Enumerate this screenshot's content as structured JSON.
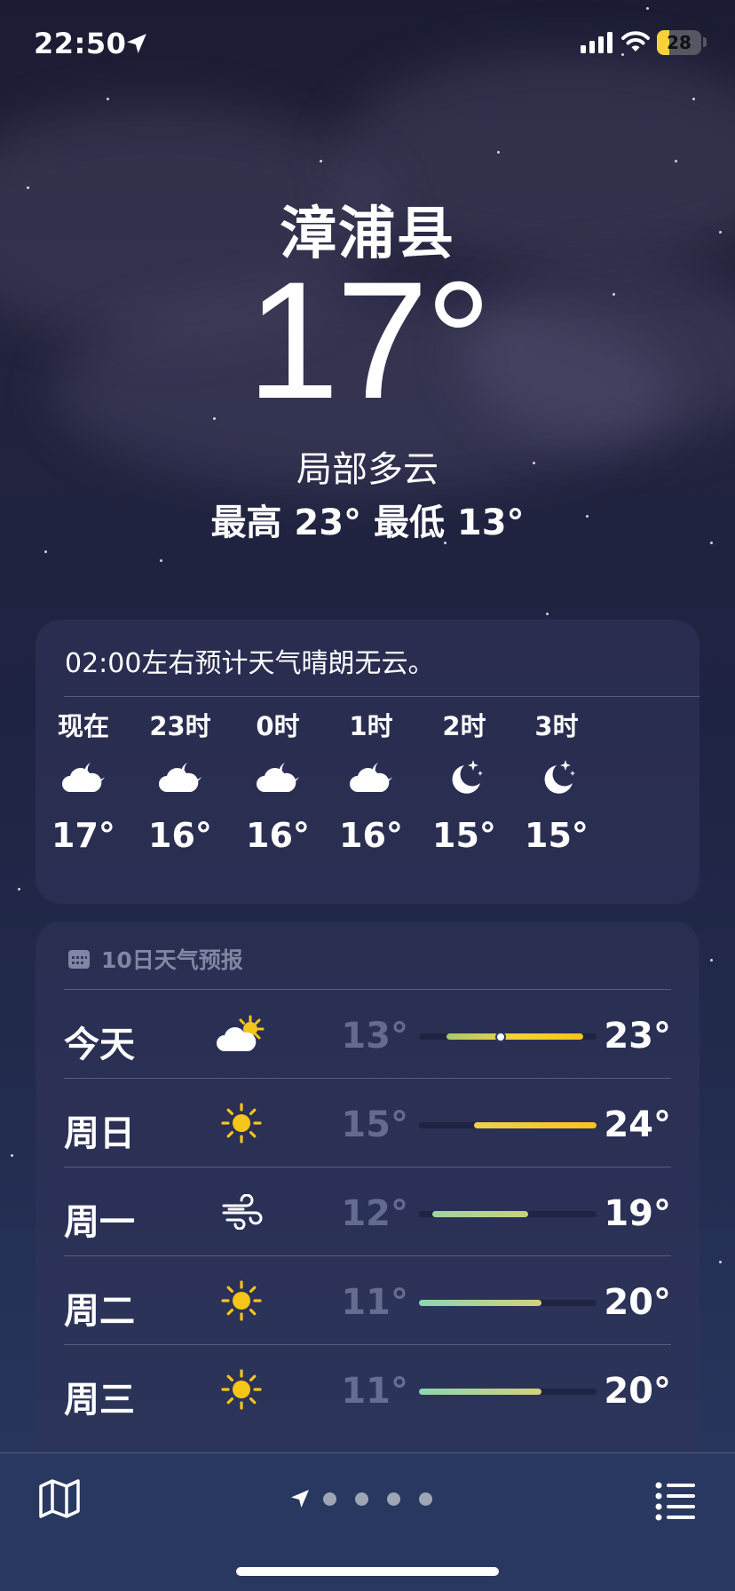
{
  "status_bar": {
    "time": "22:50",
    "battery": "28",
    "battery_level": 0.28,
    "icons": [
      "location-arrow-icon",
      "signal-icon",
      "wifi-icon",
      "battery-charging-icon"
    ]
  },
  "location": {
    "city": "漳浦县",
    "temperature": "17°",
    "condition": "局部多云",
    "high_low": "最高 23°  最低 13°"
  },
  "hourly": {
    "summary": "02:00左右预计天气晴朗无云。",
    "items": [
      {
        "label": "现在",
        "icon": "cloud-moon-icon",
        "temp": "17°"
      },
      {
        "label": "23时",
        "icon": "cloud-moon-icon",
        "temp": "16°"
      },
      {
        "label": "0时",
        "icon": "cloud-moon-icon",
        "temp": "16°"
      },
      {
        "label": "1时",
        "icon": "cloud-moon-icon",
        "temp": "16°"
      },
      {
        "label": "2时",
        "icon": "moon-stars-icon",
        "temp": "15°"
      },
      {
        "label": "3时",
        "icon": "moon-stars-icon",
        "temp": "15°"
      }
    ]
  },
  "daily": {
    "header": "10日天气预报",
    "header_icon": "calendar-icon",
    "range_min": 11,
    "range_max": 24,
    "days": [
      {
        "day": "今天",
        "icon": "cloud-sun-icon",
        "low": "13°",
        "high": "23°",
        "low_value": 13,
        "high_value": 23,
        "current_value": 17,
        "colors": [
          "#a8c96a",
          "#f3d23b",
          "#f7c31c"
        ]
      },
      {
        "day": "周日",
        "icon": "sun-icon",
        "low": "15°",
        "high": "24°",
        "low_value": 15,
        "high_value": 24,
        "colors": [
          "#f1cf52",
          "#f7c31c"
        ]
      },
      {
        "day": "周一",
        "icon": "wind-icon",
        "low": "12°",
        "high": "19°",
        "low_value": 12,
        "high_value": 19,
        "colors": [
          "#9fd4a0",
          "#c6d27c"
        ]
      },
      {
        "day": "周二",
        "icon": "sun-icon",
        "low": "11°",
        "high": "20°",
        "low_value": 11,
        "high_value": 20,
        "colors": [
          "#8ad6b4",
          "#d4d17a"
        ]
      },
      {
        "day": "周三",
        "icon": "sun-icon",
        "low": "11°",
        "high": "20°",
        "low_value": 11,
        "high_value": 20,
        "colors": [
          "#8ad6b4",
          "#d4d17a"
        ]
      }
    ]
  },
  "bottom_bar": {
    "left_icon": "map-icon",
    "right_icon": "list-icon",
    "page_count": 4
  }
}
